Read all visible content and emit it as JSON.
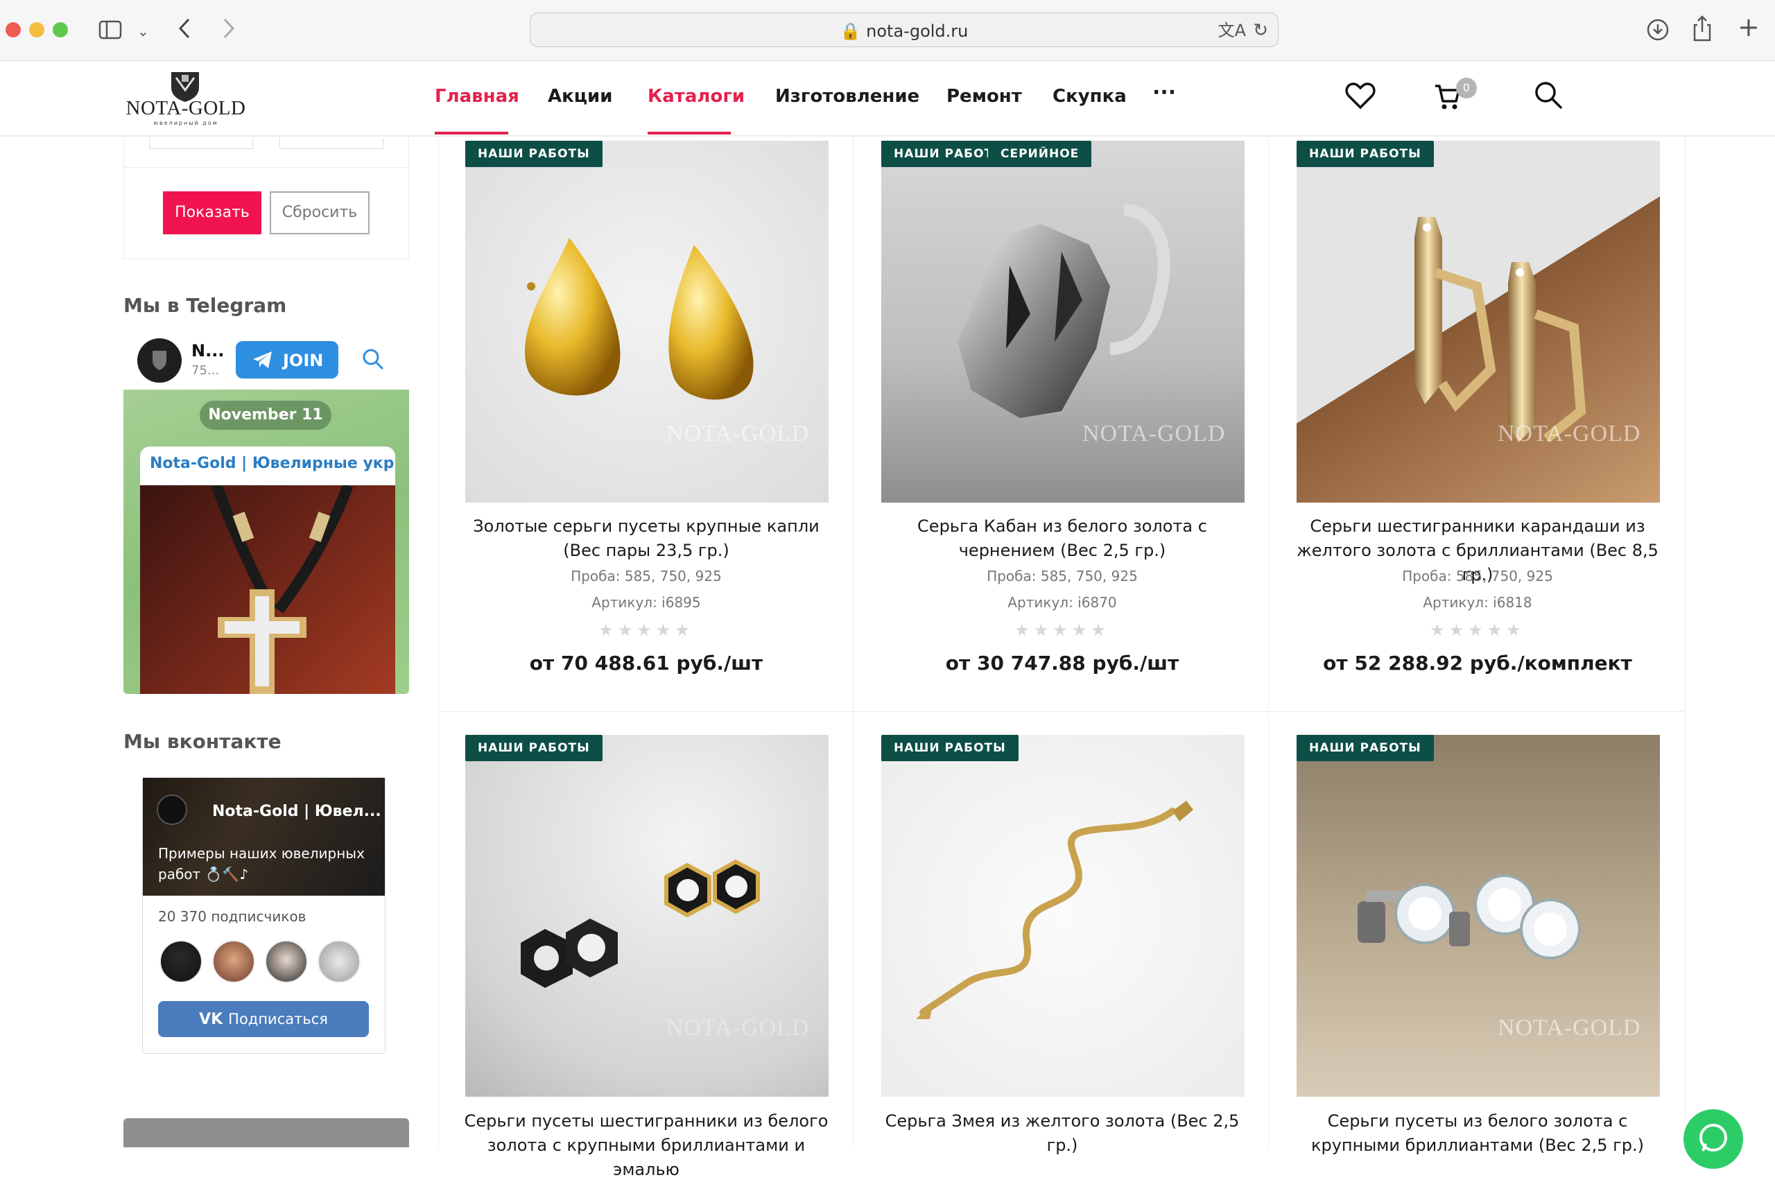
{
  "browser": {
    "url": "nota-gold.ru",
    "translate_icon": "translate-icon",
    "reload_icon": "reload-icon"
  },
  "header": {
    "logo_text": "NOTA-GOLD",
    "logo_sub": "ювелирный дом",
    "nav": [
      {
        "label": "Главная"
      },
      {
        "label": "Акции"
      },
      {
        "label": "Каталоги"
      },
      {
        "label": "Изготовление"
      },
      {
        "label": "Ремонт"
      },
      {
        "label": "Скупка"
      },
      {
        "label": "···"
      }
    ],
    "cart_count": "0",
    "accent": "#e3224e"
  },
  "filter": {
    "show_label": "Показать",
    "reset_label": "Сбросить"
  },
  "telegram": {
    "section_title": "Мы в Telegram",
    "channel_short": "N...",
    "subs_short": "75...",
    "join_label": "JOIN",
    "date_pill": "November 11",
    "post_title": "Nota-Gold | Ювелирные укр..."
  },
  "vk": {
    "section_title": "Мы вконтакте",
    "group_name": "Nota-Gold | Ювел...",
    "group_desc": "Примеры наших ювелирных работ 💍🔨♪",
    "subscribers": "20 370 подписчиков",
    "subscribe_label": "Подписаться"
  },
  "products": [
    {
      "badges": [
        "НАШИ РАБОТЫ"
      ],
      "title": "Золотые серьги пусеты крупные капли (Вес пары 23,5 гр.)",
      "proba": "Проба: 585, 750, 925",
      "article": "Артикул: i6895",
      "price": "от 70 488.61 руб./шт",
      "rating": 0
    },
    {
      "badges": [
        "НАШИ РАБОТЫ",
        "СЕРИЙНОЕ"
      ],
      "title": "Серьга Кабан из белого золота с чернением (Вес 2,5 гр.)",
      "proba": "Проба: 585, 750, 925",
      "article": "Артикул: i6870",
      "price": "от 30 747.88 руб./шт",
      "rating": 0
    },
    {
      "badges": [
        "НАШИ РАБОТЫ"
      ],
      "title": "Серьги шестигранники карандаши из желтого золота с бриллиантами (Вес 8,5 гр.)",
      "proba": "Проба: 585, 750, 925",
      "article": "Артикул: i6818",
      "price": "от 52 288.92 руб./комплект",
      "rating": 0
    },
    {
      "badges": [
        "НАШИ РАБОТЫ"
      ],
      "title": "Серьги пусеты шестигранники из белого золота с крупными бриллиантами и эмалью"
    },
    {
      "badges": [
        "НАШИ РАБОТЫ"
      ],
      "title": "Серьга Змея из желтого золота (Вес 2,5 гр.)"
    },
    {
      "badges": [
        "НАШИ РАБОТЫ"
      ],
      "title": "Серьги пусеты из белого золота с крупными бриллиантами (Вес 2,5 гр.)"
    }
  ],
  "watermark": "NOTA-GOLD",
  "stars_text": "★★★★★",
  "icons": {
    "wishlist": "heart-icon",
    "cart": "cart-icon",
    "search": "search-icon",
    "whatsapp": "whatsapp-icon"
  }
}
